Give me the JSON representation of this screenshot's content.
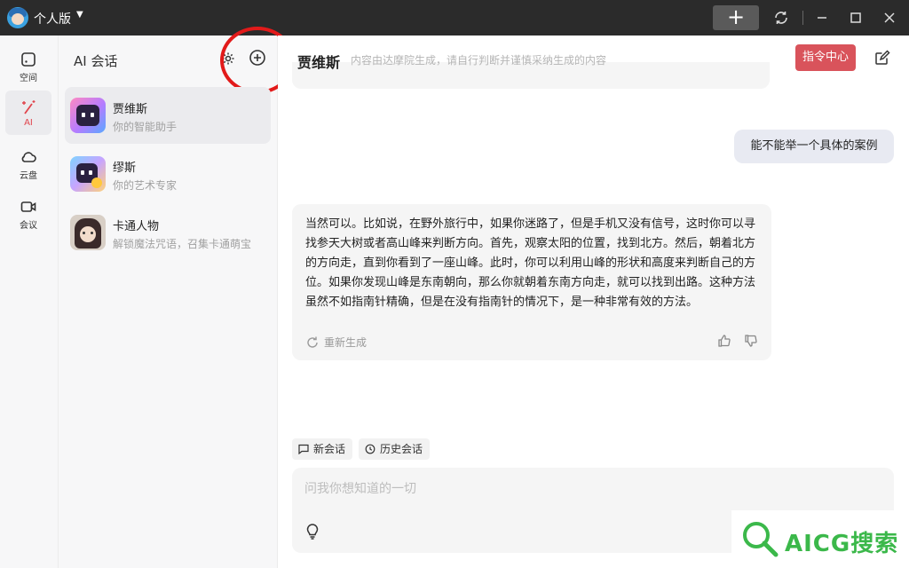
{
  "titlebar": {
    "edition": "个人版",
    "new_button": "+"
  },
  "rail": {
    "items": [
      {
        "label": "空间",
        "icon": "space-icon"
      },
      {
        "label": "AI",
        "icon": "magic-wand-icon",
        "active": true
      },
      {
        "label": "云盘",
        "icon": "cloud-icon"
      },
      {
        "label": "会议",
        "icon": "video-icon"
      }
    ]
  },
  "sessions": {
    "header": "AI 会话",
    "items": [
      {
        "name": "贾维斯",
        "desc": "你的智能助手",
        "active": true
      },
      {
        "name": "缪斯",
        "desc": "你的艺术专家"
      },
      {
        "name": "卡通人物",
        "desc": "解锁魔法咒语，召集卡通萌宝"
      }
    ]
  },
  "chat": {
    "title": "贾维斯",
    "subtitle": "内容由达摩院生成，请自行判断并谨慎采纳生成的内容",
    "command_center": "指令中心",
    "user_message": "能不能举一个具体的案例",
    "ai_message": "当然可以。比如说，在野外旅行中，如果你迷路了，但是手机又没有信号，这时你可以寻找参天大树或者高山峰来判断方向。首先，观察太阳的位置，找到北方。然后，朝着北方的方向走，直到你看到了一座山峰。此时，你可以利用山峰的形状和高度来判断自己的方位。如果你发现山峰是东南朝向，那么你就朝着东南方向走，就可以找到出路。这种方法虽然不如指南针精确，但是在没有指南针的情况下，是一种非常有效的方法。",
    "regenerate": "重新生成",
    "new_session": "新会话",
    "history": "历史会话",
    "input_placeholder": "问我你想知道的一切"
  },
  "watermark": {
    "text": "AICG搜索"
  },
  "colors": {
    "accent_red": "#d9535b",
    "annotation_red": "#e21a1a",
    "watermark_green": "#3bb84a"
  }
}
